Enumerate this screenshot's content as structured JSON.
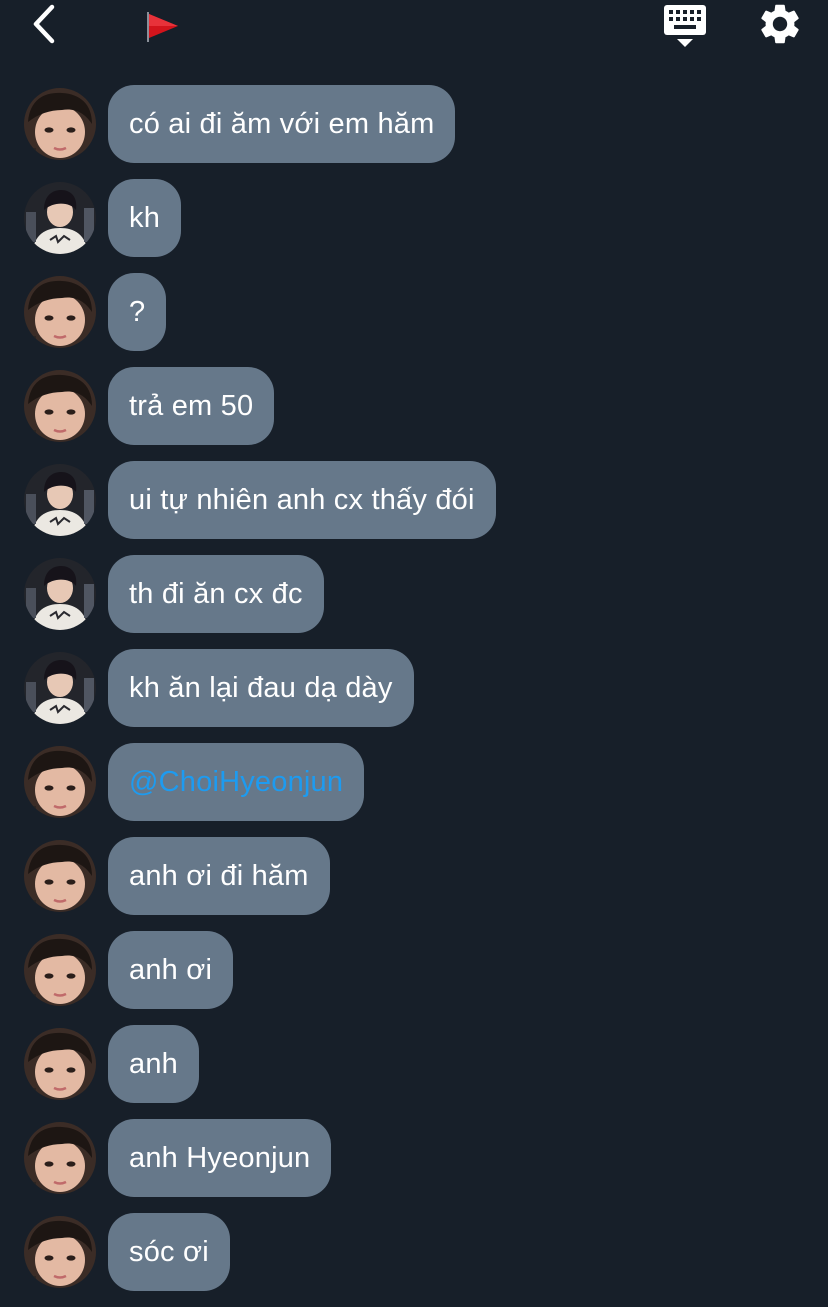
{
  "header": {
    "back_icon": "chevron-left-icon",
    "flag_icon": "red-flag-icon",
    "keyboard_icon": "keyboard-icon",
    "settings_icon": "gear-icon"
  },
  "colors": {
    "background": "#171f29",
    "bubble": "#66788a",
    "text": "#ffffff",
    "mention": "#1d9bf0",
    "flag": "#d3141c"
  },
  "messages": [
    {
      "sender": "a",
      "text": "có ai đi ăm với em hăm"
    },
    {
      "sender": "b",
      "text": "kh"
    },
    {
      "sender": "a",
      "text": "?"
    },
    {
      "sender": "a",
      "text": "trả em 50"
    },
    {
      "sender": "b",
      "text": "ui tự nhiên anh cx thấy đói"
    },
    {
      "sender": "b",
      "text": "th đi ăn cx đc"
    },
    {
      "sender": "b",
      "text": "kh ăn lại đau dạ dày"
    },
    {
      "sender": "a",
      "text": "@ChoiHyeonjun",
      "mention": true
    },
    {
      "sender": "a",
      "text": "anh ơi đi hăm"
    },
    {
      "sender": "a",
      "text": "anh ơi"
    },
    {
      "sender": "a",
      "text": "anh"
    },
    {
      "sender": "a",
      "text": "anh Hyeonjun"
    },
    {
      "sender": "a",
      "text": "sóc ơi"
    }
  ]
}
